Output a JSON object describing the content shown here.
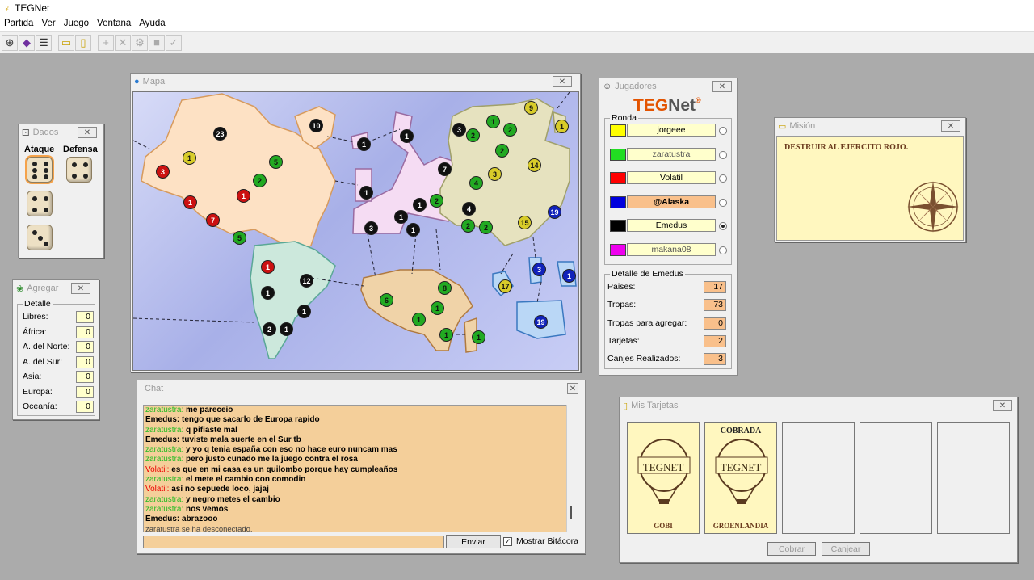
{
  "app": {
    "title": "TEGNet"
  },
  "menu": [
    "Partida",
    "Ver",
    "Juego",
    "Ventana",
    "Ayuda"
  ],
  "toolbar": [
    {
      "icon": "connect-icon",
      "glyph": "⊕"
    },
    {
      "icon": "start-icon",
      "glyph": "◆"
    },
    {
      "icon": "list-icon",
      "glyph": "☰"
    },
    {
      "icon": "mission-icon",
      "glyph": "▭"
    },
    {
      "icon": "cards-icon",
      "glyph": "▯"
    },
    {
      "icon": "add-icon",
      "glyph": "+"
    },
    {
      "icon": "attack-icon",
      "glyph": "✕"
    },
    {
      "icon": "regroup-icon",
      "glyph": "⚙"
    },
    {
      "icon": "card-take-icon",
      "glyph": "■"
    },
    {
      "icon": "end-turn-icon",
      "glyph": "✓"
    }
  ],
  "map": {
    "title": "Mapa",
    "colors": {
      "ocean": "#aab2e8",
      "north_america": "#fde1c4",
      "south_america": "#cce8dc",
      "europe": "#f5dcf3",
      "asia": "#e6e2bf",
      "africa": "#f0d3a8",
      "oceania": "#bad7f6"
    },
    "armies": [
      {
        "n": "23",
        "c": "black"
      },
      {
        "n": "10",
        "c": "black"
      },
      {
        "n": "1",
        "c": "yellow"
      },
      {
        "n": "3",
        "c": "red"
      },
      {
        "n": "5",
        "c": "green"
      },
      {
        "n": "2",
        "c": "green"
      },
      {
        "n": "1",
        "c": "red"
      },
      {
        "n": "1",
        "c": "red"
      },
      {
        "n": "7",
        "c": "red"
      },
      {
        "n": "5",
        "c": "green"
      },
      {
        "n": "1",
        "c": "red"
      },
      {
        "n": "12",
        "c": "black"
      },
      {
        "n": "1",
        "c": "black"
      },
      {
        "n": "1",
        "c": "black"
      },
      {
        "n": "2",
        "c": "black"
      },
      {
        "n": "1",
        "c": "black"
      },
      {
        "n": "1",
        "c": "black"
      },
      {
        "n": "1",
        "c": "black"
      },
      {
        "n": "7",
        "c": "black"
      },
      {
        "n": "1",
        "c": "black"
      },
      {
        "n": "1",
        "c": "black"
      },
      {
        "n": "1",
        "c": "black"
      },
      {
        "n": "2",
        "c": "green"
      },
      {
        "n": "3",
        "c": "black"
      },
      {
        "n": "1",
        "c": "black"
      },
      {
        "n": "3",
        "c": "black"
      },
      {
        "n": "2",
        "c": "green"
      },
      {
        "n": "1",
        "c": "green"
      },
      {
        "n": "2",
        "c": "green"
      },
      {
        "n": "9",
        "c": "yellow"
      },
      {
        "n": "1",
        "c": "yellow"
      },
      {
        "n": "2",
        "c": "green"
      },
      {
        "n": "3",
        "c": "yellow"
      },
      {
        "n": "14",
        "c": "yellow"
      },
      {
        "n": "4",
        "c": "green"
      },
      {
        "n": "4",
        "c": "black"
      },
      {
        "n": "2",
        "c": "green"
      },
      {
        "n": "2",
        "c": "green"
      },
      {
        "n": "15",
        "c": "yellow"
      },
      {
        "n": "19",
        "c": "blue"
      },
      {
        "n": "6",
        "c": "green"
      },
      {
        "n": "8",
        "c": "green"
      },
      {
        "n": "1",
        "c": "green"
      },
      {
        "n": "1",
        "c": "green"
      },
      {
        "n": "1",
        "c": "green"
      },
      {
        "n": "1",
        "c": "green"
      },
      {
        "n": "17",
        "c": "yellow"
      },
      {
        "n": "3",
        "c": "blue"
      },
      {
        "n": "1",
        "c": "blue"
      },
      {
        "n": "19",
        "c": "blue"
      }
    ]
  },
  "dados": {
    "title": "Dados",
    "ataque_label": "Ataque",
    "defensa_label": "Defensa",
    "ataque": [
      6,
      4,
      3
    ],
    "defensa": [
      4
    ]
  },
  "agregar": {
    "title": "Agregar",
    "legend": "Detalle",
    "rows": [
      {
        "label": "Libres:",
        "value": "0"
      },
      {
        "label": "África:",
        "value": "0"
      },
      {
        "label": "A. del Norte:",
        "value": "0"
      },
      {
        "label": "A. del Sur:",
        "value": "0"
      },
      {
        "label": "Asia:",
        "value": "0"
      },
      {
        "label": "Europa:",
        "value": "0"
      },
      {
        "label": "Oceanía:",
        "value": "0"
      }
    ]
  },
  "jugadores": {
    "title": "Jugadores",
    "logo_a": "TEG",
    "logo_b": "Net",
    "logo_mark": "®",
    "ronda_legend": "Ronda",
    "players": [
      {
        "name": "jorgeee",
        "color": "#ffff00",
        "bg": "#ffffcc",
        "bold": false,
        "selected": false
      },
      {
        "name": "zaratustra",
        "color": "#22dd22",
        "bg": "#ffffcc",
        "bold": false,
        "selected": false
      },
      {
        "name": "Volatil",
        "color": "#ff0000",
        "bg": "#ffffcc",
        "bold": false,
        "selected": false
      },
      {
        "name": "@Alaska",
        "color": "#0000dd",
        "bg": "#f9c08b",
        "bold": true,
        "selected": false
      },
      {
        "name": "Emedus",
        "color": "#000000",
        "bg": "#ffffcc",
        "bold": false,
        "selected": true
      },
      {
        "name": "makana08",
        "color": "#ee00ee",
        "bg": "#ffffcc",
        "bold": false,
        "selected": false
      }
    ],
    "detalle_legend": "Detalle de Emedus",
    "detalle": [
      {
        "label": "Paises:",
        "value": "17"
      },
      {
        "label": "Tropas:",
        "value": "73"
      },
      {
        "label": "Tropas para agregar:",
        "value": "0"
      },
      {
        "label": "Tarjetas:",
        "value": "2"
      },
      {
        "label": "Canjes Realizados:",
        "value": "3"
      }
    ]
  },
  "mision": {
    "title": "Misión",
    "text": "DESTRUIR AL EJERCITO ROJO."
  },
  "chat": {
    "title": "Chat",
    "lines": [
      {
        "name": "zaratustra:",
        "color": "#22bb22",
        "text": " me pareceio"
      },
      {
        "name": "Emedus:",
        "color": "#000000",
        "text": " tengo que sacarlo de Europa rapido"
      },
      {
        "name": "zaratustra:",
        "color": "#22bb22",
        "text": " q pifiaste mal"
      },
      {
        "name": "Emedus:",
        "color": "#000000",
        "text": " tuviste mala suerte en el Sur tb"
      },
      {
        "name": "zaratustra:",
        "color": "#22bb22",
        "text": " y yo q tenia españa con eso no hace euro nuncam mas"
      },
      {
        "name": "zaratustra:",
        "color": "#22bb22",
        "text": " pero justo cunado me la juego contra el rosa"
      },
      {
        "name": "Volatil:",
        "color": "#ee0000",
        "text": " es que en mi casa es un quilombo porque hay cumpleaños"
      },
      {
        "name": "zaratustra:",
        "color": "#22bb22",
        "text": " el mete el cambio con comodin"
      },
      {
        "name": "Volatil:",
        "color": "#ee0000",
        "text": " así no sepuede loco, jajaj"
      },
      {
        "name": "zaratustra:",
        "color": "#22bb22",
        "text": " y negro metes el cambio"
      },
      {
        "name": "zaratustra:",
        "color": "#22bb22",
        "text": " nos vemos"
      },
      {
        "name": "Emedus:",
        "color": "#000000",
        "text": " abrazooo"
      }
    ],
    "system_line": "zaratustra se ha desconectado.",
    "send_label": "Enviar",
    "show_log_label": "Mostrar Bitácora"
  },
  "tarjetas": {
    "title": "Mis Tarjetas",
    "logo": "TEGNET",
    "cards": [
      {
        "header": "",
        "name": "GOBI"
      },
      {
        "header": "COBRADA",
        "name": "GROENLANDIA"
      }
    ],
    "cobrar_label": "Cobrar",
    "canjear_label": "Canjear"
  }
}
